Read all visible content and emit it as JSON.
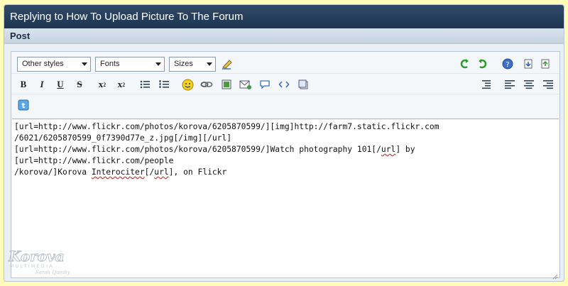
{
  "header": {
    "title": "Replying to How To Upload Picture To The Forum"
  },
  "section": {
    "label": "Post"
  },
  "toolbar": {
    "style_select": "Other styles",
    "font_select": "Fonts",
    "size_select": "Sizes",
    "bold": "B",
    "italic": "I",
    "underline": "U",
    "strike": "S",
    "subscript": "x",
    "subscript_mark": "2",
    "superscript": "x",
    "superscript_mark": "2"
  },
  "editor": {
    "line1": "[url=http://www.flickr.com/photos/korova/6205870599/][img]http://farm7.static.flickr.com",
    "line2": "/6021/6205870599_0f7390d77e_z.jpg[/img][/url]",
    "line3a": "[url=http://www.flickr.com/photos/korova/6205870599/]Watch photography 101[/",
    "line3b": "url",
    "line3c": "] by [url=http://www.flickr.com/people",
    "line4a": "/korova/]Korova ",
    "line4b": "Interociter",
    "line4c": "[/",
    "line4d": "url",
    "line4e": "], on Flickr"
  },
  "watermark": {
    "brand": "Korova",
    "sub": "MULTIMEDIA",
    "tagline": "Sarah Quinby"
  },
  "colors": {
    "title_bar": "#1d3552",
    "background": "#fdfcb8",
    "panel": "#e9eff4"
  }
}
